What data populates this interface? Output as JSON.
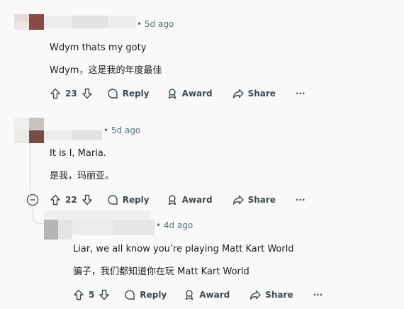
{
  "comments": [
    {
      "timestamp": "• 5d ago",
      "text_en": "Wdym thats my goty",
      "text_zh": "Wdym，这是我的年度最佳",
      "votes": "23",
      "actions": {
        "reply": "Reply",
        "award": "Award",
        "share": "Share",
        "more": "···"
      }
    },
    {
      "timestamp": "• 5d ago",
      "text_en": "It is I, Maria.",
      "text_zh": "是我，玛丽亚。",
      "votes": "22",
      "actions": {
        "reply": "Reply",
        "award": "Award",
        "share": "Share",
        "more": "···"
      }
    },
    {
      "timestamp": "• 4d ago",
      "text_en": "Liar, we all know you’re playing Matt Kart World",
      "text_zh": "骗子，我们都知道你在玩 Matt Kart World",
      "votes": "5",
      "actions": {
        "reply": "Reply",
        "award": "Award",
        "share": "Share",
        "more": "···"
      }
    }
  ],
  "icons": {
    "upvote": "upvote-arrow-icon",
    "downvote": "downvote-arrow-icon",
    "reply": "speech-bubble-icon",
    "award": "award-medal-icon",
    "share": "share-arrow-icon",
    "collapse": "collapse-minus-icon"
  },
  "colors": {
    "background": "#f9f9f9",
    "text": "#1c1c1c",
    "meta": "#576f76",
    "action": "#3c4a52",
    "thread_line": "#d5dadd"
  }
}
